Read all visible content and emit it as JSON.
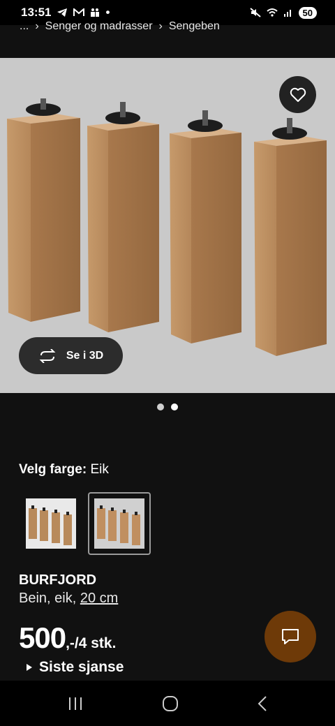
{
  "status_bar": {
    "time": "13:51",
    "left_icons": [
      "telegram-icon",
      "gmail-icon",
      "teams-icon",
      "dot-icon"
    ],
    "right_icons": [
      "mute-icon",
      "wifi-icon",
      "signal-icon"
    ],
    "battery": "50"
  },
  "breadcrumb": {
    "ellipsis": "...",
    "items": [
      "Senger og madrasser",
      "Sengeben"
    ]
  },
  "gallery": {
    "view_3d_label": "Se i 3D",
    "dot_count": 2,
    "active_dot": 1
  },
  "color_selector": {
    "label": "Velg farge:",
    "value": "Eik"
  },
  "product": {
    "name": "BURFJORD",
    "desc_prefix": "Bein, eik, ",
    "desc_size": "20 cm",
    "price_main": "500",
    "price_suffix": ",-/4 stk.",
    "badge": "Siste sjanse"
  },
  "colors": {
    "background": "#111111",
    "chat_button": "#6e3a08",
    "gallery_bg": "#c9c9c9",
    "wood": "#b98b5e"
  }
}
